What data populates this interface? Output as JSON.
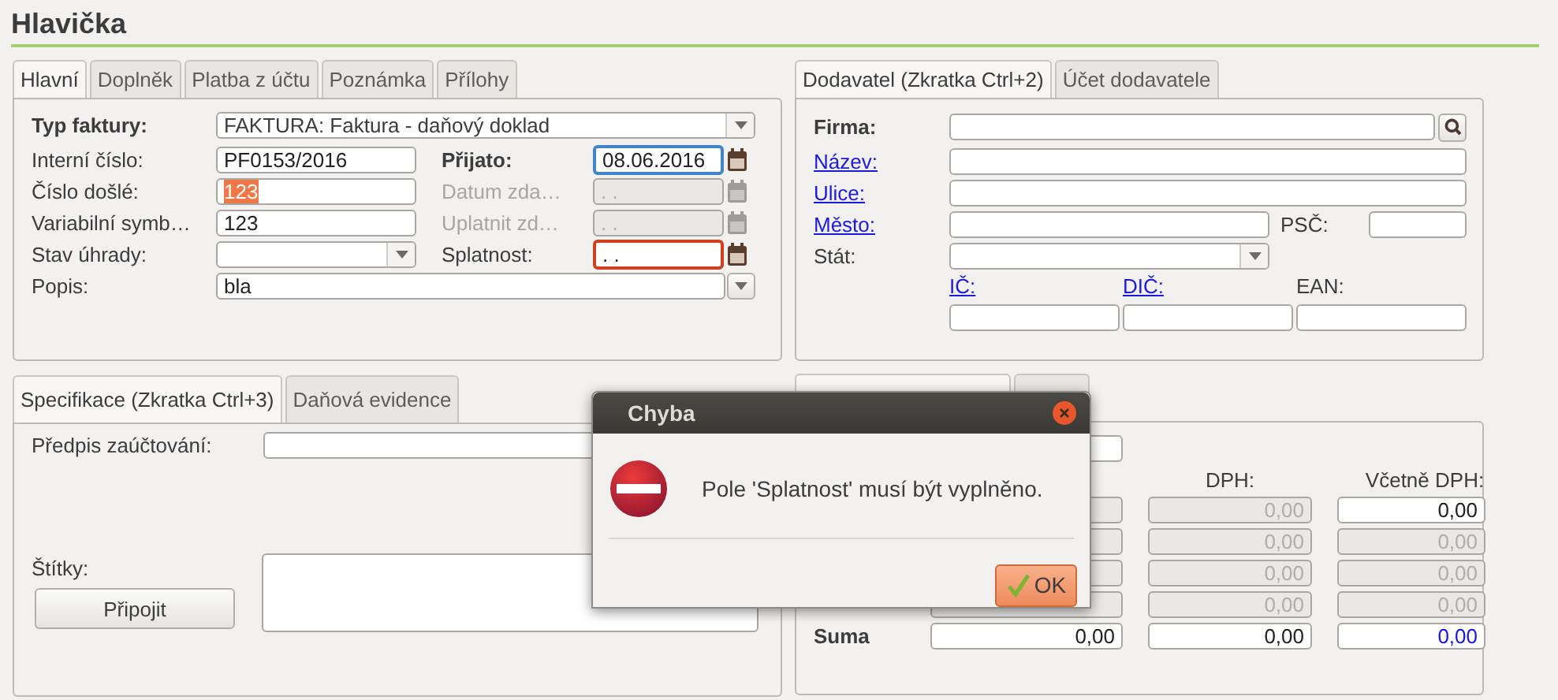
{
  "header": {
    "title": "Hlavička"
  },
  "invoice": {
    "tabs": [
      {
        "label": "Hlavní",
        "selected": true
      },
      {
        "label": "Doplněk",
        "selected": false
      },
      {
        "label": "Platba z účtu",
        "selected": false
      },
      {
        "label": "Poznámka",
        "selected": false
      },
      {
        "label": "Přílohy",
        "selected": false
      }
    ],
    "type": {
      "label": "Typ faktury:",
      "value": "FAKTURA: Faktura - daňový doklad",
      "required": true
    },
    "left_fields": [
      {
        "kind": "text",
        "label": "Interní číslo:",
        "value": "PF0153/2016",
        "text_selected": false
      },
      {
        "kind": "text",
        "label": "Číslo došlé:",
        "value": "123",
        "text_selected": true
      },
      {
        "kind": "text",
        "label": "Variabilní symb…",
        "value": "123",
        "text_selected": false
      },
      {
        "kind": "select",
        "label": "Stav úhrady:"
      }
    ],
    "dates": [
      {
        "label": "Přijato:",
        "value": "08.06.2016",
        "required": true,
        "disabled": false,
        "focused": true,
        "error": false
      },
      {
        "label": "Datum zda…",
        "value": ". .",
        "required": false,
        "disabled": true,
        "focused": false,
        "error": false
      },
      {
        "label": "Uplatnit zd…",
        "value": ". .",
        "required": false,
        "disabled": true,
        "focused": false,
        "error": false
      },
      {
        "label": "Splatnost:",
        "value": ". .",
        "required": false,
        "disabled": false,
        "focused": false,
        "error": true
      }
    ],
    "description": {
      "label": "Popis:",
      "value": "bla"
    }
  },
  "supplier": {
    "tabs": [
      {
        "label": "Dodavatel (Zkratka Ctrl+2)",
        "selected": true
      },
      {
        "label": "Účet dodavatele",
        "selected": false
      }
    ],
    "company": {
      "label": "Firma:",
      "required": true
    },
    "name": {
      "label": "Název:",
      "link": true
    },
    "street": {
      "label": "Ulice:",
      "link": true
    },
    "city": {
      "label": "Město:",
      "link": true
    },
    "zip": {
      "label": "PSČ:"
    },
    "country": {
      "label": "Stát:"
    },
    "ids": [
      {
        "label": "IČ:",
        "link": true
      },
      {
        "label": "DIČ:",
        "link": true
      },
      {
        "label": "EAN:",
        "link": false
      }
    ]
  },
  "specification": {
    "tabs": [
      {
        "label": "Specifikace (Zkratka Ctrl+3)",
        "selected": true
      },
      {
        "label": "Daňová evidence",
        "selected": false
      }
    ],
    "posting": {
      "label": "Předpis zaúčtování:"
    },
    "tags": {
      "label": "Štítky:",
      "button": "Připojit"
    }
  },
  "totals": {
    "tabs": [
      {
        "selected": true
      },
      {
        "selected": false
      }
    ],
    "headers": [
      "DPH:",
      "Včetně DPH:"
    ],
    "rows": [
      {
        "kind": "rate",
        "dph": "0,00",
        "incl": "0,00",
        "incl_disabled": false
      },
      {
        "kind": "rate",
        "dph": "0,00",
        "incl": "0,00",
        "incl_disabled": true
      },
      {
        "kind": "rate",
        "dph": "0,00",
        "incl": "0,00",
        "incl_disabled": true
      },
      {
        "kind": "rate",
        "dph": "0,00",
        "incl": "0,00",
        "incl_disabled": true
      },
      {
        "kind": "sum",
        "label": "Suma",
        "base": "0,00",
        "dph": "0,00",
        "incl": "0,00",
        "incl_disabled": false
      }
    ]
  },
  "dialog": {
    "title": "Chyba",
    "message": "Pole 'Splatnost' musí být vyplněno.",
    "button": "OK"
  }
}
